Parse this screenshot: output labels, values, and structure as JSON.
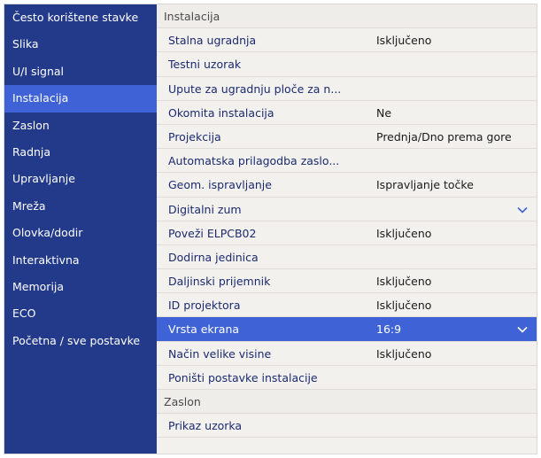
{
  "sidebar": {
    "items": [
      {
        "label": "Često korištene stavke",
        "active": false
      },
      {
        "label": "Slika",
        "active": false
      },
      {
        "label": "U/I signal",
        "active": false
      },
      {
        "label": "Instalacija",
        "active": true
      },
      {
        "label": "Zaslon",
        "active": false
      },
      {
        "label": "Radnja",
        "active": false
      },
      {
        "label": "Upravljanje",
        "active": false
      },
      {
        "label": "Mreža",
        "active": false
      },
      {
        "label": "Olovka/dodir",
        "active": false
      },
      {
        "label": "Interaktivna",
        "active": false
      },
      {
        "label": "Memorija",
        "active": false
      },
      {
        "label": "ECO",
        "active": false
      },
      {
        "label": "Početna / sve postavke",
        "active": false
      }
    ]
  },
  "main": {
    "section_title": "Instalacija",
    "rows": [
      {
        "label": "Stalna ugradnja",
        "value": "Isključeno"
      },
      {
        "label": "Testni uzorak",
        "value": ""
      },
      {
        "label": "Upute za ugradnju ploče za n...",
        "value": ""
      },
      {
        "label": "Okomita instalacija",
        "value": "Ne"
      },
      {
        "label": "Projekcija",
        "value": "Prednja/Dno prema gore"
      },
      {
        "label": "Automatska prilagodba zaslo...",
        "value": ""
      },
      {
        "label": "Geom. ispravljanje",
        "value": "Ispravljanje točke"
      },
      {
        "label": "Digitalni zum",
        "value": "",
        "chevron": true
      },
      {
        "label": "Poveži ELPCB02",
        "value": "Isključeno"
      },
      {
        "label": "Dodirna jedinica",
        "value": ""
      },
      {
        "label": "Daljinski prijemnik",
        "value": "Isključeno"
      },
      {
        "label": "ID projektora",
        "value": "Isključeno"
      },
      {
        "label": "Vrsta ekrana",
        "value": "16:9",
        "chevron": true,
        "selected": true
      },
      {
        "label": "Način velike visine",
        "value": "Isključeno"
      },
      {
        "label": "Poništi postavke instalacije",
        "value": ""
      }
    ],
    "next_section_title": "Zaslon",
    "next_rows": [
      {
        "label": "Prikaz uzorka",
        "value": ""
      }
    ]
  },
  "icons": {
    "expand": "chevron-down-icon"
  },
  "colors": {
    "sidebar_bg": "#233a8b",
    "highlight": "#3f63d6",
    "text_blue": "#1b2a6e",
    "panel_bg": "#f3f1ee"
  }
}
